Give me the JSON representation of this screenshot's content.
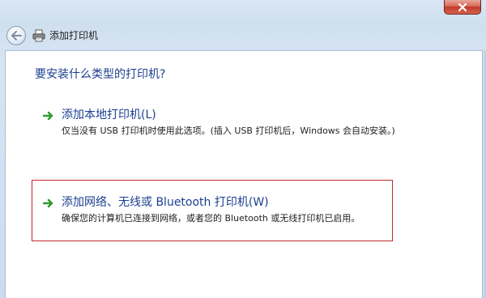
{
  "window": {
    "title": "添加打印机"
  },
  "content": {
    "heading": "要安装什么类型的打印机?",
    "options": [
      {
        "title": "添加本地打印机(L)",
        "description": "仅当没有 USB 打印机时使用此选项。(插入 USB 打印机后，Windows 会自动安装。)"
      },
      {
        "title": "添加网络、无线或 Bluetooth 打印机(W)",
        "description": "确保您的计算机已连接到网络，或者您的 Bluetooth 或无线打印机已启用。"
      }
    ]
  },
  "colors": {
    "link_blue": "#1b3f8f",
    "highlight_red": "#c2272d",
    "arrow_green": "#2f9b2f"
  },
  "icons": [
    "close-icon",
    "back-arrow-icon",
    "printer-icon",
    "green-arrow-icon"
  ]
}
